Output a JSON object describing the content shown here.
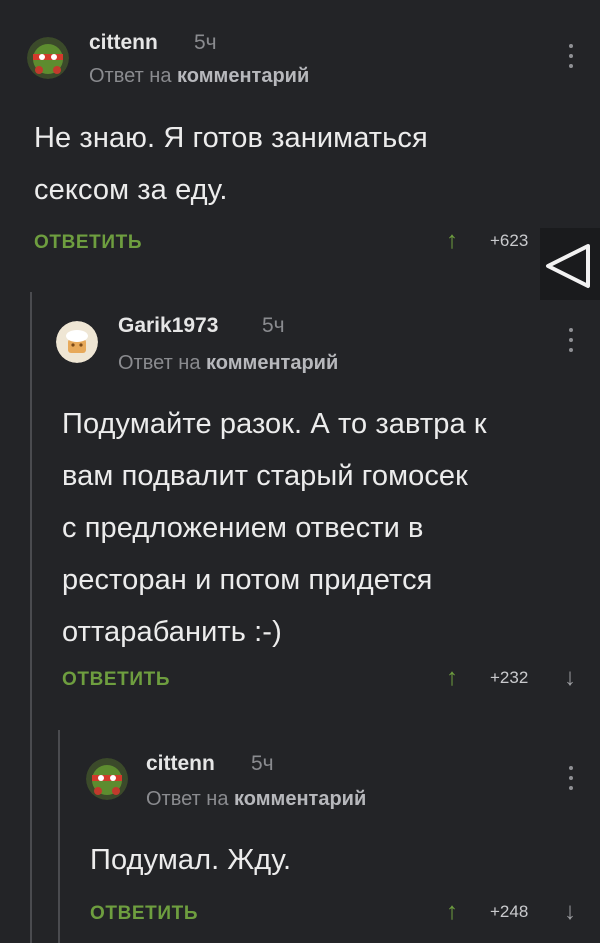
{
  "comments": [
    {
      "username": "cittenn",
      "time": "5ч",
      "reply_prefix": "Ответ на",
      "reply_target": "комментарий",
      "lines": [
        "Не знаю. Я готов заниматься",
        "сексом за еду."
      ],
      "reply_label": "ОТВЕТИТЬ",
      "score": "+623",
      "avatar": "turtle-avatar"
    },
    {
      "username": "Garik1973",
      "time": "5ч",
      "reply_prefix": "Ответ на",
      "reply_target": "комментарий",
      "lines": [
        "Подумайте разок. А то завтра к",
        "вам подвалит старый гомосек",
        "с предложением отвести в",
        "ресторан и потом придется",
        "оттарабанить :-)"
      ],
      "reply_label": "ОТВЕТИТЬ",
      "score": "+232",
      "avatar": "chef-avatar"
    },
    {
      "username": "cittenn",
      "time": "5ч",
      "reply_prefix": "Ответ на",
      "reply_target": "комментарий",
      "lines": [
        "Подумал. Жду."
      ],
      "reply_label": "ОТВЕТИТЬ",
      "score": "+248",
      "avatar": "turtle-avatar"
    }
  ],
  "icons": {
    "upvote": "arrow-up-icon",
    "downvote": "arrow-down-icon",
    "menu": "more-vertical-icon",
    "back": "back-triangle-icon"
  },
  "colors": {
    "background": "#232427",
    "accent": "#6e9e3f",
    "muted": "#8a8b8f"
  }
}
